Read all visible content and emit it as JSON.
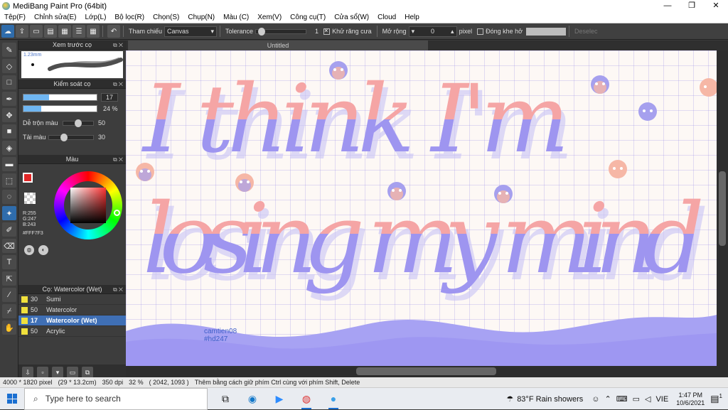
{
  "window": {
    "title": "MediBang Paint Pro (64bit)",
    "minimize": "—",
    "maximize": "❐",
    "close": "✕"
  },
  "menu": [
    "Tệp(F)",
    "Chỉnh sửa(E)",
    "Lớp(L)",
    "Bộ lọc(R)",
    "Chọn(S)",
    "Chụp(N)",
    "Màu (C)",
    "Xem(V)",
    "Công cụ(T)",
    "Cửa sổ(W)",
    "Cloud",
    "Help"
  ],
  "toolbar": {
    "reference_label": "Tham chiếu",
    "reference_value": "Canvas",
    "tolerance_label": "Tolerance",
    "tolerance_value": "1",
    "tolerance_level": 0.05,
    "antialias_label": "Khử răng cưa",
    "antialias_checked": true,
    "expand_label": "Mở rộng",
    "expand_value": "0",
    "expand_unit": "pixel",
    "close_gap_label": "Đóng khe hở",
    "close_gap_checked": false,
    "deselect_label": "Deselec"
  },
  "panels": {
    "preview_title": "Xem trước cọ",
    "preview_size": "1.23mm",
    "brush_control_title": "Kiểm soát cọ",
    "brush_size": "17",
    "brush_size_level": 0.35,
    "brush_opacity": "24 %",
    "brush_opacity_level": 0.24,
    "blend_label": "Dễ trộn màu",
    "blend_value": "50",
    "blend_level": 0.5,
    "reload_label": "Tải màu",
    "reload_value": "30",
    "reload_level": 0.3,
    "color_title": "Màu",
    "rgb_r": "R:255",
    "rgb_g": "G:247",
    "rgb_b": "B:243",
    "hex": "#FFF7F3",
    "brush_list_title": "Cọ: Watercolor (Wet)",
    "brushes": [
      {
        "size": "30",
        "name": "Sumi",
        "selected": false
      },
      {
        "size": "50",
        "name": "Watercolor",
        "selected": false
      },
      {
        "size": "17",
        "name": "Watercolor (Wet)",
        "selected": true
      },
      {
        "size": "50",
        "name": "Acrylic",
        "selected": false
      }
    ]
  },
  "canvas": {
    "tab_title": "Untitled",
    "lettering": [
      "I think I'm",
      "losing my mind"
    ],
    "signature_line1": "camtien08",
    "signature_line2": "#hd247"
  },
  "status": {
    "dimensions": "4000 * 1820 pixel",
    "physical": "(29 * 13.2cm)",
    "dpi": "350 dpi",
    "zoom": "32 %",
    "cursor": "( 2042, 1093 )",
    "hint": "Thêm bằng cách giữ phím Ctrl cùng với phím Shift, Delete"
  },
  "taskbar": {
    "search_placeholder": "Type here to search",
    "weather": "83°F  Rain showers",
    "lang": "VIE",
    "time": "1:47 PM",
    "date": "10/6/2021",
    "notifications": "1"
  },
  "colors": {
    "accent": "#2f6cab",
    "primary": "#e02626",
    "secondary": "#ffffff",
    "letter_pink": "#f4a6a6",
    "letter_purple": "#9b93f0"
  }
}
